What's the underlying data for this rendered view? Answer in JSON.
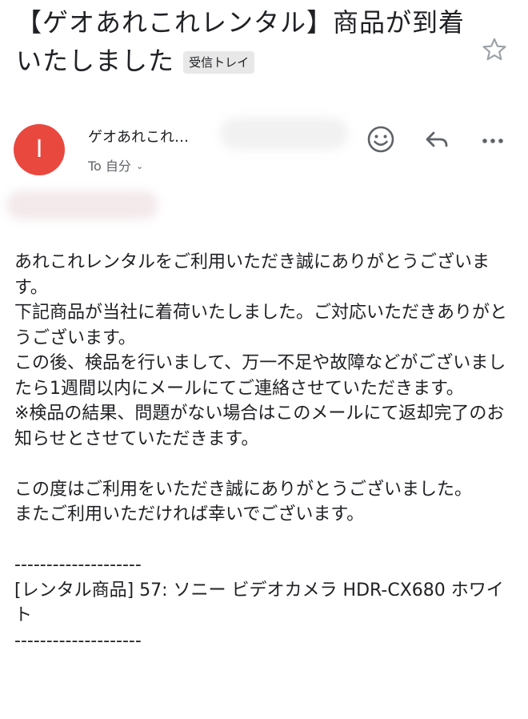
{
  "email": {
    "subject": "【ゲオあれこれレンタル】商品が到着いたしました",
    "folder_chip": "受信トレイ",
    "avatar_initial": "I",
    "sender_name": "ゲオあれこれ…",
    "to_label": "To 自分",
    "body_paragraphs_1": [
      "あれこれレンタルをご利用いただき誠にありがとうございます。",
      "下記商品が当社に着荷いたしました。ご対応いただきありがとうございます。",
      "この後、検品を行いまして、万一不足や故障などがございましたら1週間以内にメールにてご連絡させていただきます。",
      "※検品の結果、問題がない場合はこのメールにて返却完了のお知らせとさせていただきます。"
    ],
    "body_paragraphs_2": [
      "この度はご利用をいただき誠にありがとうございました。",
      "またご利用いただければ幸いでございます。"
    ],
    "divider": "--------------------",
    "rental_item": "[レンタル商品] 57: ソニー ビデオカメラ HDR-CX680 ホワイト",
    "divider_end": "--------------------"
  },
  "icons": {
    "star": "star-icon",
    "emoji": "emoji-icon",
    "reply": "reply-icon",
    "more": "more-icon",
    "chevron": "chevron-down-icon"
  },
  "colors": {
    "avatar_bg": "#e9483f",
    "chip_bg": "#e8e8e8",
    "icon": "#5f6368"
  }
}
